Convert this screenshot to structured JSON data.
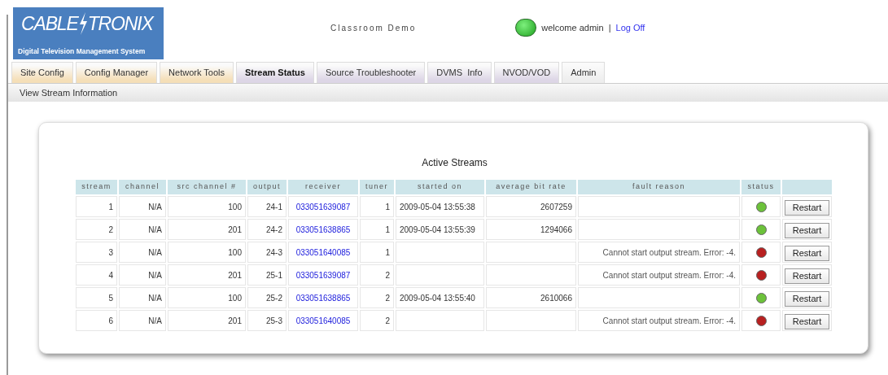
{
  "logo": {
    "brand_left": "CABLE",
    "brand_right": "TRONIX",
    "tagline": "Digital Television Management System"
  },
  "site_name": "Classroom Demo",
  "user": {
    "online": true,
    "welcome": "welcome admin",
    "separator": "|",
    "logout": "Log Off"
  },
  "tabs": [
    {
      "label": "Site Config",
      "selected": false,
      "color": "#f5dfb8"
    },
    {
      "label": "Config Manager",
      "selected": false,
      "color": "#f5dfb8"
    },
    {
      "label": "Network Tools",
      "selected": false,
      "color": "#f5dfb8"
    },
    {
      "label": "Stream Status",
      "selected": true,
      "color": "#ddd6e6"
    },
    {
      "label": "Source Troubleshooter",
      "selected": false,
      "color": "#ddd6e6"
    },
    {
      "label": "DVMS  Info",
      "selected": false,
      "color": "#ddd6e6"
    },
    {
      "label": "NVOD/VOD",
      "selected": false,
      "color": "#ddd6e6"
    },
    {
      "label": "Admin",
      "selected": false,
      "color": "#eeeeee"
    }
  ],
  "subnav": {
    "label": "View Stream Information"
  },
  "table": {
    "title": "Active Streams",
    "columns": [
      "stream",
      "channel",
      "src channel #",
      "output",
      "receiver",
      "tuner",
      "started on",
      "average bit rate",
      "fault reason",
      "status"
    ],
    "rows": [
      {
        "stream": "1",
        "channel": "N/A",
        "src_channel": "100",
        "output": "24-1",
        "receiver": "033051639087",
        "tuner": "1",
        "started_on": "2009-05-04 13:55:38",
        "bit_rate": "2607259",
        "color": "#6cc23a",
        "action": "Restart"
      },
      {
        "stream": "2",
        "channel": "N/A",
        "src_channel": "201",
        "output": "24-2",
        "receiver": "033051638865",
        "tuner": "1",
        "started_on": "2009-05-04 13:55:39",
        "bit_rate": "1294066",
        "color": "#6cc23a",
        "action": "Restart"
      },
      {
        "stream": "3",
        "channel": "N/A",
        "src_channel": "100",
        "output": "24-3",
        "receiver": "033051640085",
        "tuner": "1",
        "fault_reason": "Cannot start output stream. Error: -4.",
        "color": "#b82020",
        "action": "Restart"
      },
      {
        "stream": "4",
        "channel": "N/A",
        "src_channel": "201",
        "output": "25-1",
        "receiver": "033051639087",
        "tuner": "2",
        "fault_reason": "Cannot start output stream. Error: -4.",
        "color": "#b82020",
        "action": "Restart"
      },
      {
        "stream": "5",
        "channel": "N/A",
        "src_channel": "100",
        "output": "25-2",
        "receiver": "033051638865",
        "tuner": "2",
        "started_on": "2009-05-04 13:55:40",
        "bit_rate": "2610066",
        "color": "#6cc23a",
        "action": "Restart"
      },
      {
        "stream": "6",
        "channel": "N/A",
        "src_channel": "201",
        "output": "25-3",
        "receiver": "033051640085",
        "tuner": "2",
        "fault_reason": "Cannot start output stream. Error: -4.",
        "color": "#b82020",
        "action": "Restart"
      }
    ]
  }
}
